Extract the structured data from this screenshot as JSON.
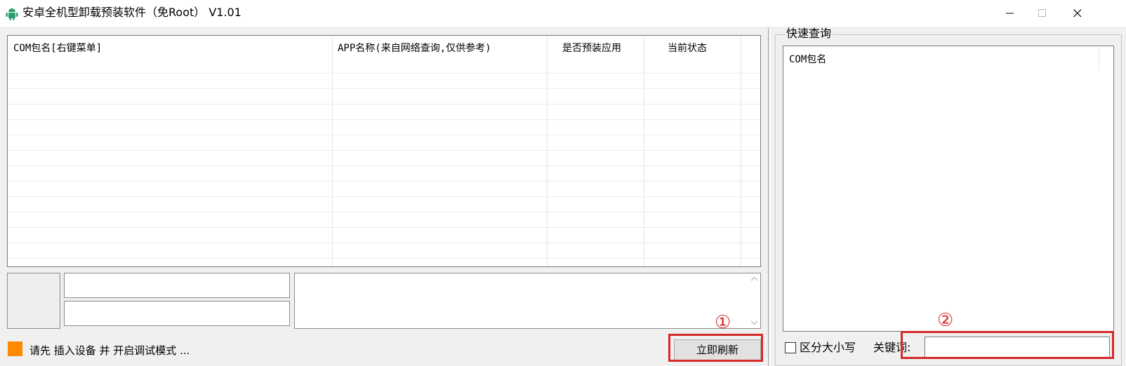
{
  "window": {
    "title": "安卓全机型卸载预装软件（免Root） V1.01",
    "icon": "android-icon"
  },
  "table": {
    "columns": [
      "COM包名[右键菜单]",
      "APP名称(来自网络查询,仅供参考)",
      "是否预装应用",
      "当前状态"
    ],
    "rows": []
  },
  "status": {
    "message": "请先 插入设备 并 开启调试模式 ...",
    "indicator_color": "#ff8a00"
  },
  "buttons": {
    "refresh": "立即刷新"
  },
  "annotations": {
    "marker1": "①",
    "marker2": "②",
    "color": "#d42a2a"
  },
  "quick_query": {
    "legend": "快速查询",
    "column": "COM包名",
    "case_sensitive_label": "区分大小写",
    "case_sensitive_checked": false,
    "keyword_label": "关键词:",
    "keyword_value": ""
  }
}
